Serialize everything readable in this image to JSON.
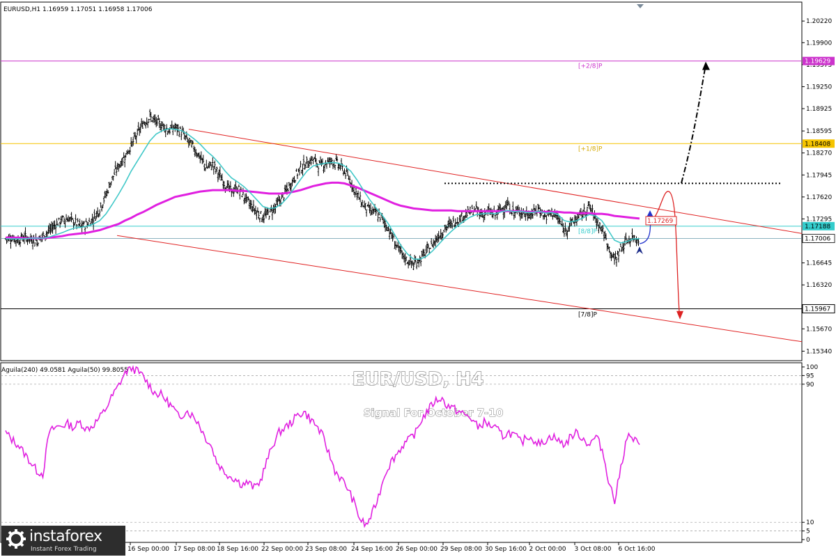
{
  "window": {
    "header": "EURUSD,H1  1.16959 1.17051 1.16958 1.17006"
  },
  "chart_data": [
    {
      "type": "candlestick",
      "symbol": "EURUSD",
      "timeframe": "H1",
      "title": "EUR/USD, H4",
      "subtitle": "Signal For October 7-10",
      "ohlc_last": {
        "open": 1.16959,
        "high": 1.17051,
        "low": 1.16958,
        "close": 1.17006
      },
      "ylim": [
        1.152,
        1.205
      ],
      "y_ticks": [
        "1.20220",
        "1.19900",
        "1.19575",
        "1.19250",
        "1.18925",
        "1.18595",
        "1.18270",
        "1.17945",
        "1.17620",
        "1.17295",
        "1.16970",
        "1.16645",
        "1.16320",
        "1.15995",
        "1.15670",
        "1.15340"
      ],
      "x_labels": [
        "16 Sep 00:00",
        "17 Sep 08:00",
        "18 Sep 16:00",
        "22 Sep 00:00",
        "23 Sep 08:00",
        "24 Sep 16:00",
        "26 Sep 00:00",
        "29 Sep 08:00",
        "30 Sep 16:00",
        "2 Oct 00:00",
        "3 Oct 08:00",
        "6 Oct 16:00"
      ],
      "x_label_edge_left": "S",
      "x_label_edge_partial": "16:00",
      "price_series": [
        1.17,
        1.1702,
        1.1698,
        1.1703,
        1.17,
        1.1697,
        1.1705,
        1.1712,
        1.1722,
        1.1728,
        1.173,
        1.1725,
        1.1718,
        1.1722,
        1.173,
        1.1745,
        1.1765,
        1.179,
        1.1808,
        1.1822,
        1.1838,
        1.1855,
        1.1872,
        1.188,
        1.1872,
        1.1868,
        1.186,
        1.1865,
        1.1858,
        1.1845,
        1.1835,
        1.182,
        1.1805,
        1.181,
        1.1795,
        1.178,
        1.177,
        1.1775,
        1.1762,
        1.175,
        1.174,
        1.1732,
        1.1738,
        1.1748,
        1.176,
        1.1775,
        1.179,
        1.1805,
        1.1812,
        1.1818,
        1.1808,
        1.1812,
        1.1816,
        1.181,
        1.18,
        1.1785,
        1.1765,
        1.175,
        1.1742,
        1.1738,
        1.173,
        1.1715,
        1.1695,
        1.1678,
        1.1668,
        1.1662,
        1.167,
        1.168,
        1.1692,
        1.1705,
        1.1715,
        1.1722,
        1.1728,
        1.1735,
        1.174,
        1.1742,
        1.1736,
        1.174,
        1.1735,
        1.1745,
        1.175,
        1.1738,
        1.1742,
        1.1735,
        1.1738,
        1.1745,
        1.1732,
        1.174,
        1.173,
        1.1712,
        1.1722,
        1.173,
        1.1738,
        1.1748,
        1.173,
        1.1715,
        1.169,
        1.1668,
        1.1685,
        1.1698,
        1.1702,
        1.17
      ],
      "ma_fast": [
        1.17,
        1.17,
        1.17,
        1.17,
        1.1701,
        1.1701,
        1.1701,
        1.1703,
        1.1706,
        1.1709,
        1.1713,
        1.1716,
        1.1717,
        1.1719,
        1.1722,
        1.1727,
        1.1737,
        1.1751,
        1.1766,
        1.1782,
        1.18,
        1.1815,
        1.183,
        1.1845,
        1.1855,
        1.186,
        1.1863,
        1.1862,
        1.186,
        1.1855,
        1.1848,
        1.184,
        1.183,
        1.1822,
        1.1812,
        1.18,
        1.179,
        1.1784,
        1.1777,
        1.1768,
        1.1758,
        1.1748,
        1.1745,
        1.1746,
        1.1752,
        1.1762,
        1.1775,
        1.1788,
        1.18,
        1.1808,
        1.181,
        1.1812,
        1.1813,
        1.1812,
        1.1808,
        1.18,
        1.1787,
        1.1772,
        1.1758,
        1.1746,
        1.1735,
        1.1722,
        1.1706,
        1.169,
        1.1678,
        1.167,
        1.167,
        1.1674,
        1.1682,
        1.1692,
        1.1702,
        1.1711,
        1.1719,
        1.1726,
        1.1732,
        1.1736,
        1.1737,
        1.1738,
        1.1737,
        1.174,
        1.1742,
        1.174,
        1.1741,
        1.1739,
        1.1739,
        1.1741,
        1.1738,
        1.1739,
        1.1736,
        1.1727,
        1.1725,
        1.1727,
        1.1731,
        1.1736,
        1.1734,
        1.1727,
        1.1713,
        1.1698,
        1.1694,
        1.1696,
        1.17,
        1.17
      ],
      "ma_slow": [
        1.1702,
        1.1702,
        1.1702,
        1.1701,
        1.1701,
        1.1701,
        1.1701,
        1.1702,
        1.1703,
        1.1704,
        1.1706,
        1.1707,
        1.1708,
        1.1709,
        1.1711,
        1.1713,
        1.1716,
        1.1719,
        1.1722,
        1.1727,
        1.1731,
        1.1736,
        1.174,
        1.1745,
        1.175,
        1.1754,
        1.1758,
        1.1762,
        1.1764,
        1.1766,
        1.1768,
        1.177,
        1.1771,
        1.1772,
        1.1772,
        1.1772,
        1.1772,
        1.1771,
        1.1771,
        1.177,
        1.1769,
        1.1768,
        1.1767,
        1.1767,
        1.1767,
        1.1768,
        1.177,
        1.1772,
        1.1775,
        1.1778,
        1.178,
        1.1782,
        1.1783,
        1.1783,
        1.1782,
        1.1779,
        1.1776,
        1.1772,
        1.1768,
        1.1764,
        1.176,
        1.1756,
        1.1752,
        1.1749,
        1.1747,
        1.1745,
        1.1744,
        1.1743,
        1.1742,
        1.1742,
        1.1742,
        1.1742,
        1.1741,
        1.1741,
        1.1741,
        1.1741,
        1.1741,
        1.1741,
        1.1741,
        1.1741,
        1.1741,
        1.1741,
        1.1741,
        1.174,
        1.174,
        1.174,
        1.174,
        1.174,
        1.174,
        1.1739,
        1.1739,
        1.1738,
        1.1738,
        1.1738,
        1.1737,
        1.1737,
        1.1736,
        1.1734,
        1.1733,
        1.1732,
        1.1731,
        1.173
      ],
      "levels": [
        {
          "label": "[+2/8]P",
          "price": 1.19629,
          "tag": "1.19629",
          "color": "#cc33cc"
        },
        {
          "label": "[+1/8]P",
          "price": 1.18408,
          "tag": "1.18408",
          "color": "#f5c400"
        },
        {
          "label": "[8/8]P",
          "price": 1.17188,
          "tag": "1.17188",
          "color": "#33cccc"
        },
        {
          "label": "[7/8]P",
          "price": 1.15967,
          "tag": "1.15967",
          "color": "#000000"
        }
      ],
      "current_price_tag": "1.17006",
      "ma_label": "1.17269",
      "resistance_dotted": 1.1782,
      "channel": {
        "upper": [
          [
            0.23,
            1.1862
          ],
          [
            1.0,
            1.1708
          ]
        ],
        "lower": [
          [
            0.14,
            1.1705
          ],
          [
            1.0,
            1.1548
          ]
        ]
      },
      "arrows": [
        {
          "style": "dash-dot",
          "color": "#000000",
          "direction": "up",
          "target": 1.196
        },
        {
          "style": "curve",
          "color": "#2233cc",
          "direction": "up"
        },
        {
          "style": "curve",
          "color": "#dd2222",
          "direction": "down",
          "target": 1.1583
        }
      ]
    },
    {
      "type": "line",
      "header": "Aguila(240) 49.0581  Aguila(50) 99.8055",
      "ylim": [
        0,
        100
      ],
      "y_ticks": [
        "100",
        "95",
        "90",
        "10",
        "5",
        "0"
      ],
      "values": [
        62,
        58,
        55,
        50,
        45,
        40,
        38,
        62,
        65,
        66,
        67,
        65,
        68,
        64,
        66,
        70,
        75,
        82,
        88,
        95,
        100,
        98,
        95,
        90,
        85,
        84,
        80,
        76,
        70,
        75,
        72,
        68,
        60,
        55,
        45,
        40,
        37,
        35,
        32,
        33,
        30,
        34,
        45,
        55,
        62,
        65,
        68,
        72,
        74,
        70,
        66,
        60,
        50,
        40,
        35,
        30,
        22,
        12,
        8,
        15,
        25,
        38,
        45,
        50,
        55,
        58,
        62,
        70,
        75,
        80,
        82,
        78,
        76,
        74,
        72,
        70,
        65,
        68,
        66,
        64,
        60,
        62,
        60,
        56,
        60,
        58,
        55,
        58,
        60,
        57,
        55,
        60,
        62,
        58,
        55,
        60,
        52,
        35,
        22,
        42,
        60,
        58,
        55
      ]
    }
  ],
  "logo": {
    "brand": "instaforex",
    "tagline": "Instant Forex Trading",
    "gear_icon": "gear-icon"
  },
  "colors": {
    "candles": "#000000",
    "ma_fast": "#40c8c8",
    "ma_slow": "#e020e0",
    "oscillator": "#e020e0",
    "channel": "#e02020"
  }
}
